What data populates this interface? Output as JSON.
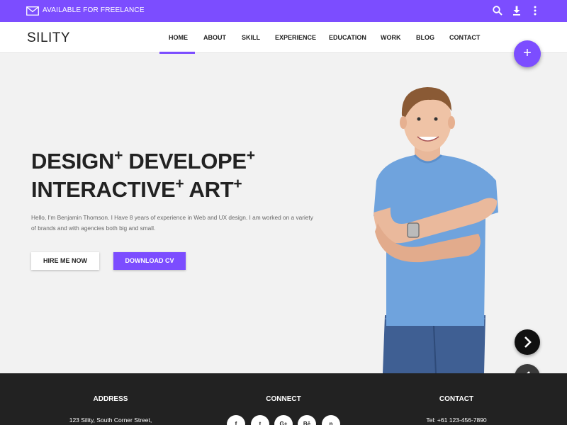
{
  "topbar": {
    "freelance_text": "AVAILABLE FOR FREELANCE",
    "icons": [
      "mail-icon",
      "search-icon",
      "download-icon",
      "more-vert-icon"
    ]
  },
  "nav": {
    "brand": "SILITY",
    "items": [
      "HOME",
      "ABOUT",
      "SKILL",
      "EXPERIENCE",
      "EDUCATION",
      "WORK",
      "BLOG",
      "CONTACT"
    ],
    "active": "HOME"
  },
  "fab": {
    "label": "+"
  },
  "hero": {
    "line1_a": "DESIGN",
    "line1_b": "DEVELOPE",
    "line2_a": "INTERACTIVE",
    "line2_b": "ART",
    "plus": "+",
    "description": "Hello, I'm Benjamin Thomson. I Have 8 years of experience in Web and UX design. I am worked on a variety of brands and with agencies both big and small.",
    "hire_label": "HIRE ME NOW",
    "cv_label": "DOWNLOAD CV"
  },
  "footer": {
    "address_title": "ADDRESS",
    "address_line": "123 Sility, South Corner Street,",
    "connect_title": "CONNECT",
    "social": [
      "f",
      "t",
      "G+",
      "Bē",
      "p"
    ],
    "contact_title": "CONTACT",
    "phone": "Tel: +61 123-456-7890"
  },
  "colors": {
    "accent": "#7c4dff",
    "footer": "#222222",
    "background": "#f2f2f2"
  }
}
